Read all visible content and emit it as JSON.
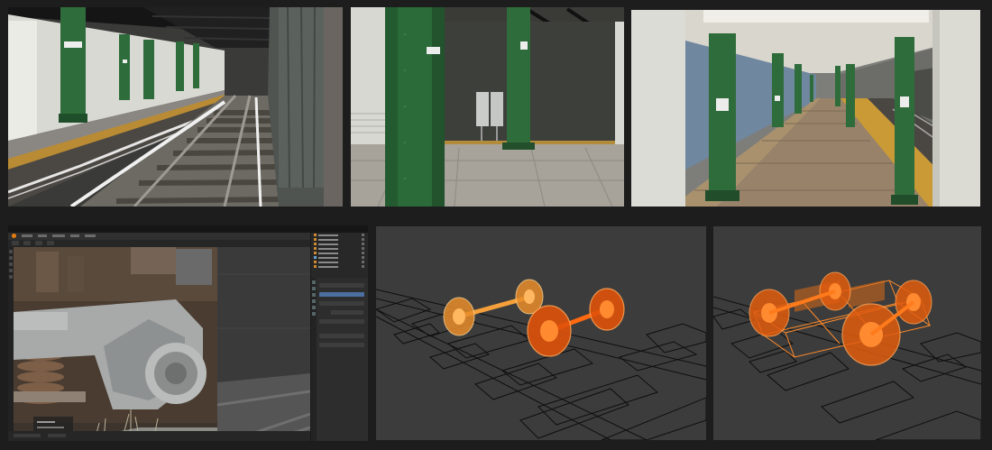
{
  "colors": {
    "background": "#1d1d1d",
    "column_green": "#2e6b3a",
    "tactile_strip_yellow": "#c89a3a",
    "wireframe_orange": "#f07a1a",
    "blender_panel": "#2d2d2d"
  },
  "panels": [
    {
      "id": "platform-tracks",
      "kind": "render"
    },
    {
      "id": "platform-wall",
      "kind": "render"
    },
    {
      "id": "platform-perspective",
      "kind": "render"
    },
    {
      "id": "blender-editor",
      "kind": "editor"
    },
    {
      "id": "wheelsets-wireframe",
      "kind": "viewport"
    },
    {
      "id": "truck-wireframe",
      "kind": "viewport"
    }
  ],
  "icons": [
    "blender-logo-icon",
    "grab-tool-icon",
    "cursor-tool-icon",
    "eye-icon",
    "camera-icon",
    "properties-tab-icon"
  ]
}
